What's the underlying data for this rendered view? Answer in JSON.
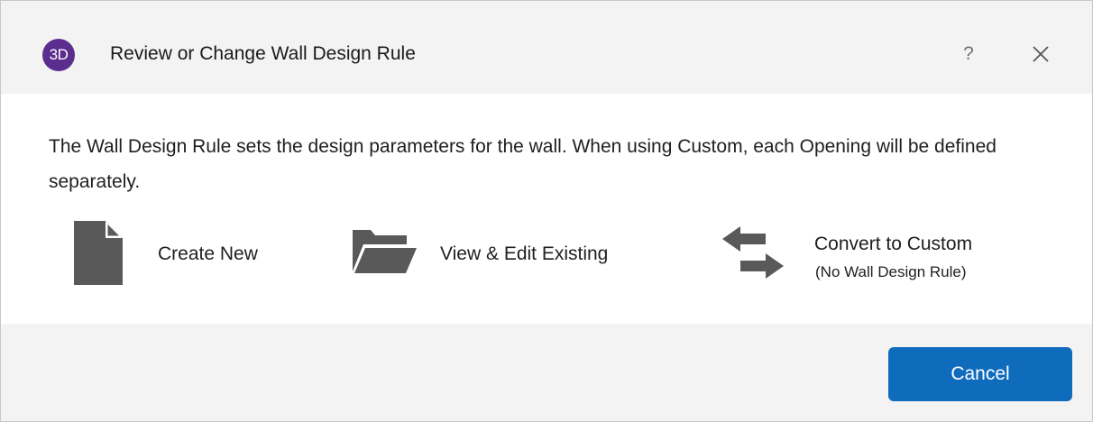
{
  "window": {
    "logo_text": "3D",
    "title": "Review or Change Wall Design Rule",
    "help_label": "?",
    "close_icon": "close-icon"
  },
  "main": {
    "description": "The Wall Design Rule sets the design parameters for the wall. When using Custom, each Opening will be defined separately.",
    "actions": [
      {
        "label": "Create New",
        "icon": "new-document-icon"
      },
      {
        "label": "View & Edit Existing",
        "icon": "folder-open-icon"
      },
      {
        "label": "Convert to Custom",
        "sublabel": "(No Wall Design Rule)",
        "icon": "swap-arrows-icon"
      }
    ]
  },
  "footer": {
    "cancel_label": "Cancel"
  },
  "colors": {
    "accent": "#0f6cbd",
    "logo": "#5b2d8e",
    "icon": "#595959",
    "chrome_bg": "#f3f3f3"
  }
}
